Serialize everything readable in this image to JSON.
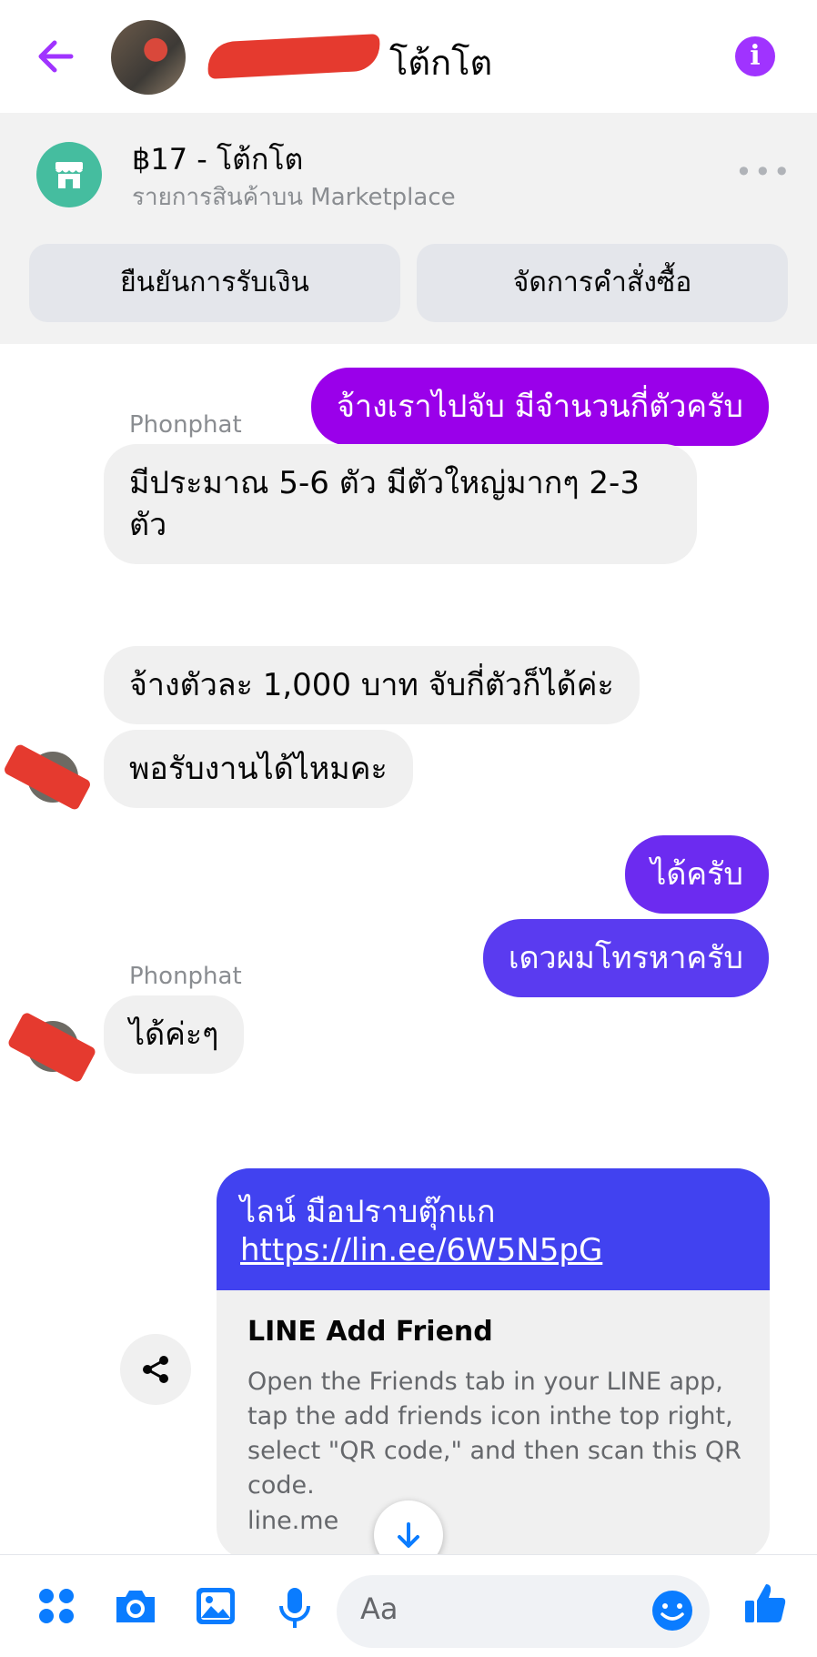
{
  "header": {
    "title": "โต้กโต",
    "back_icon": "arrow-left-icon",
    "info_icon": "info-icon",
    "accent": "#a033ff"
  },
  "marketplace": {
    "title": "฿17 - โต้กโต",
    "subtitle": "รายการสินค้าบน Marketplace",
    "more_label": "•••",
    "confirm_button": "ยืนยันการรับเงิน",
    "manage_button": "จัดการคำสั่งซื้อ"
  },
  "messages": [
    {
      "from": "me",
      "text": "จ้างเราไปจับ มีจำนวนกี่ตัวครับ"
    },
    {
      "from": "other",
      "sender": "Phonphat",
      "line1": "มีประมาณ 5-6 ตัว มีตัวใหญ่มากๆ 2-3",
      "line2": "ตัว"
    },
    {
      "from": "other",
      "text": "จ้างตัวละ 1,000 บาท จับกี่ตัวก็ได้ค่ะ"
    },
    {
      "from": "other",
      "text": "พอรับงานได้ไหมคะ"
    },
    {
      "from": "me",
      "text": "ได้ครับ"
    },
    {
      "from": "me",
      "text": "เดวผมโทรหาครับ"
    },
    {
      "from": "other",
      "sender": "Phonphat",
      "text": "ได้ค่ะๆ"
    }
  ],
  "link_card": {
    "message": "ไลน์ มือปราบตุ๊กแก",
    "url": "https://lin.ee/6W5N5pG",
    "preview_title": "LINE Add Friend",
    "preview_desc": "Open the Friends tab in your LINE app, tap the add friends icon inthe top right, select \"QR code,\" and then scan this QR code.",
    "domain": "line.me"
  },
  "composer": {
    "placeholder": "Aa"
  },
  "colors": {
    "out_purple": "#9a00ea",
    "out_violet": "#6c2bf0",
    "out_indigo": "#4142f0",
    "icon_blue": "#0a7cff"
  }
}
